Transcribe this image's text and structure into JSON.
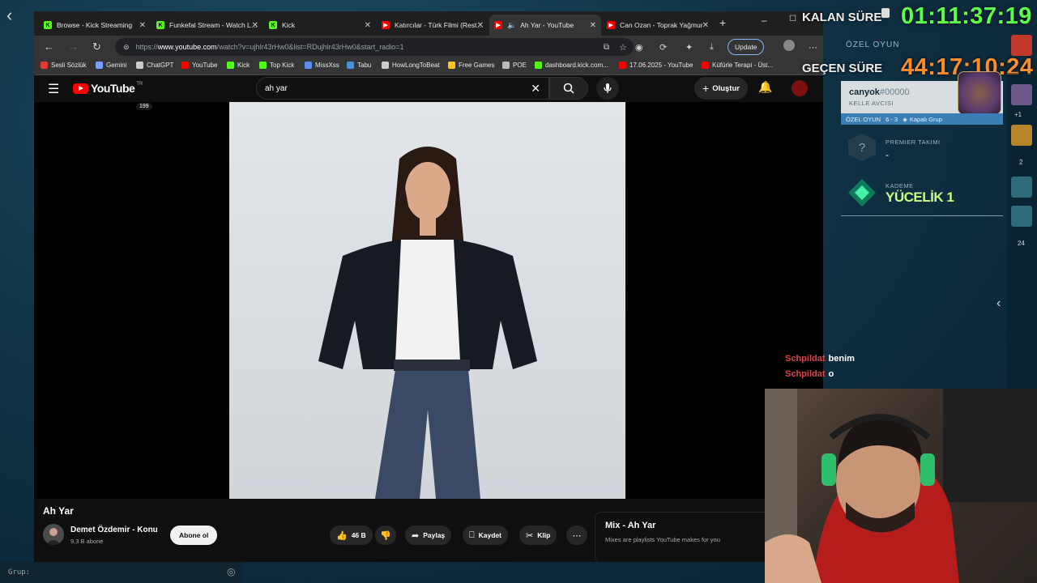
{
  "browser": {
    "tabs": [
      {
        "label": "Browse - Kick Streaming",
        "icon": "kick-icon"
      },
      {
        "label": "Funkefal Stream - Watch Live",
        "icon": "kick-icon"
      },
      {
        "label": "Kick",
        "icon": "kick-icon"
      },
      {
        "label": "Katırcılar - Türk Filmi (Restore)",
        "icon": "youtube-icon"
      },
      {
        "label": "Ah Yar - YouTube",
        "icon": "youtube-icon",
        "active": true
      },
      {
        "label": "Can Ozan - Toprak Yağmur",
        "icon": "youtube-icon"
      }
    ],
    "url_prefix": "https://",
    "url_host": "www.youtube.com",
    "url_rest": "/watch?v=ujhlr43rHw0&list=RDujhlr43rHw0&start_radio=1",
    "update_label": "Update",
    "bookmarks": [
      {
        "label": "Sesli Sözlük",
        "color": "#e53935"
      },
      {
        "label": "Gemini",
        "color": "#7c9cff"
      },
      {
        "label": "ChatGPT",
        "color": "#cccccc"
      },
      {
        "label": "YouTube",
        "color": "#ff0000"
      },
      {
        "label": "Kick",
        "color": "#53fc18"
      },
      {
        "label": "Top Kick",
        "color": "#53fc18"
      },
      {
        "label": "MissXss",
        "color": "#5b8def"
      },
      {
        "label": "Tabu",
        "color": "#4a90d9"
      },
      {
        "label": "HowLongToBeat",
        "color": "#cccccc"
      },
      {
        "label": "Free Games",
        "color": "#f5c518"
      },
      {
        "label": "POE",
        "color": "#bbbbbb"
      },
      {
        "label": "dashboard.kick.com...",
        "color": "#53fc18"
      },
      {
        "label": "17.06.2025 - YouTube",
        "color": "#ff0000"
      },
      {
        "label": "Küfürle Terapi - Üst...",
        "color": "#ff0000"
      }
    ]
  },
  "youtube": {
    "logo": "YouTube",
    "region": "TR",
    "search_query": "ah yar",
    "create_label": "Oluştur",
    "video_title": "Ah Yar",
    "channel_name": "Demet Özdemir - Konu",
    "channel_subs": "9,3 B abone",
    "subscribe_label": "Abone ol",
    "likes": "46 B",
    "share_label": "Paylaş",
    "save_label": "Kaydet",
    "clip_label": "Klip",
    "mix_title": "Mix - Ah Yar",
    "mix_subtitle": "Mixes are playlists YouTube makes for you"
  },
  "overlay": {
    "kalan_label": "KALAN SÜRE",
    "kalan_time": "01:11:37:19",
    "gecen_label": "GEÇEN SÜRE",
    "gecen_time": "44:17:10:24",
    "group_label": "Grup:"
  },
  "game": {
    "lobby_label": "ÖZEL OYUN",
    "player_name": "canyok",
    "player_tag": "#00000",
    "player_title": "KELLE AVCISI",
    "level": "199",
    "mode_label": "ÖZEL OYUN",
    "mode_score": "6 - 3",
    "group_type": "Kapalı Grup",
    "premier_label": "PREMIER TAKIMI",
    "premier_value": "-",
    "rank_label": "KADEME",
    "rank_value": "YÜCELİK 1",
    "friends_count_1": "+1",
    "friends_count_2": "2",
    "friends_count_3": "24"
  },
  "chat": [
    {
      "user": "Schpildat",
      "message": "benim"
    },
    {
      "user": "Schpildat",
      "message": "o"
    }
  ],
  "colors": {
    "kalan_time": "#5dff4c",
    "gecen_time": "#ff8c2a",
    "chat_user": "#e0424a",
    "rank": "#cdfc87"
  }
}
